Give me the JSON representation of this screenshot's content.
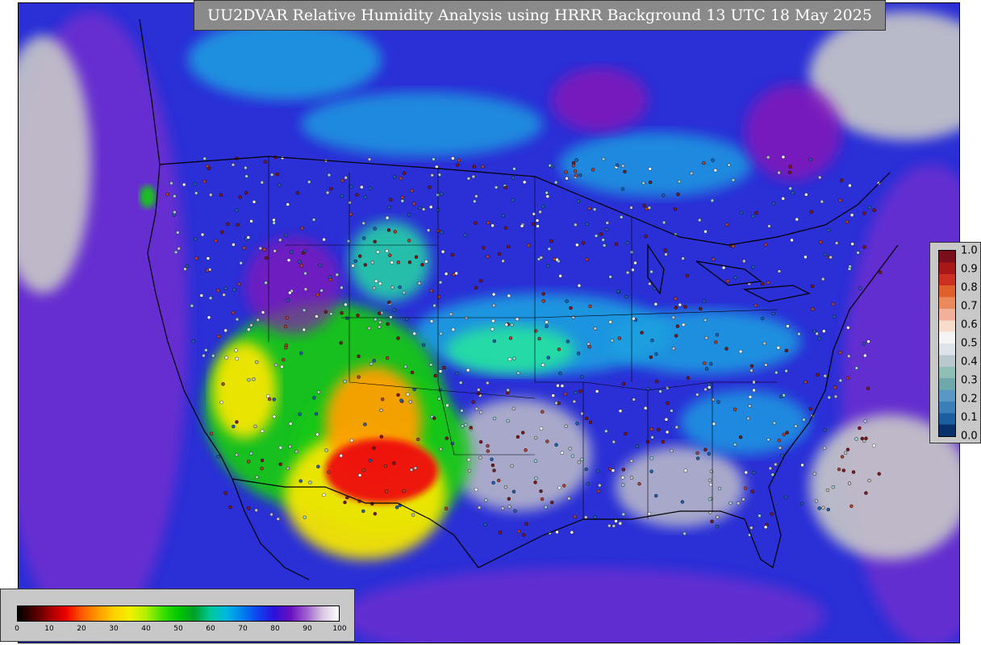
{
  "title": "UU2DVAR Relative Humidity Analysis using HRRR Background 13 UTC 18 May 2025",
  "map": {
    "base_color": "#2a2fd6",
    "ocean_color": "#6a2fd0",
    "dry_colors": [
      "#f5e600",
      "#ffa000",
      "#ee1010",
      "#18c818",
      "#28e2a0"
    ],
    "moist_colors": [
      "#1aa0e0",
      "#1050f0",
      "#8a18b8",
      "#c8c8c8"
    ],
    "station_colors": [
      "#ffffff",
      "#c0c0c0",
      "#9ad0d0",
      "#b04030",
      "#7a1a1a",
      "#2060b0"
    ]
  },
  "rh_legend": {
    "colors": [
      "#000000",
      "#4a0000",
      "#a00000",
      "#ee0000",
      "#ff5a00",
      "#ff9a00",
      "#ffd000",
      "#f0f000",
      "#b0f000",
      "#40e000",
      "#00c800",
      "#00a028",
      "#00c89a",
      "#00b8e0",
      "#0080f0",
      "#1040f0",
      "#3010d8",
      "#6a10c0",
      "#a060d0",
      "#d8c8e0",
      "#ffffff"
    ],
    "ticks": [
      "0",
      "10",
      "20",
      "30",
      "40",
      "50",
      "60",
      "70",
      "80",
      "90",
      "100"
    ]
  },
  "spread_legend": {
    "colors": [
      "#08306b",
      "#1d5e9e",
      "#3a7fb8",
      "#5b97c4",
      "#6ea8a8",
      "#8fbfb4",
      "#b8c8cc",
      "#dde3e8",
      "#f4f4f4",
      "#f7dccc",
      "#f2b09a",
      "#ea8a5c",
      "#e0602c",
      "#cc3020",
      "#a81818",
      "#7a0e1a"
    ],
    "ticks": [
      "1.0",
      "0.9",
      "0.8",
      "0.7",
      "0.6",
      "0.5",
      "0.4",
      "0.3",
      "0.2",
      "0.1",
      "0.0"
    ]
  }
}
